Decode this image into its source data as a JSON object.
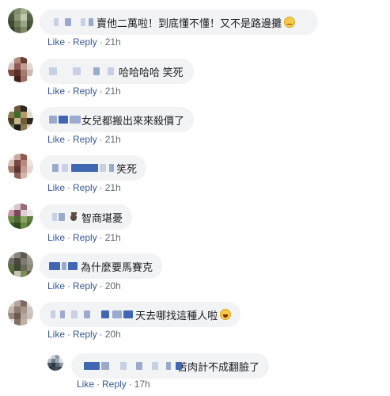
{
  "labels": {
    "like": "Like",
    "reply": "Reply",
    "sep": "·"
  },
  "colors": {
    "link": "#385898",
    "bubble": "#f2f3f5",
    "name_redacted": "#4267b2"
  },
  "comments": [
    {
      "text": "賣他二萬啦！到底懂不懂！又不是路邊攤",
      "emoji": "smirk-emoji",
      "time": "21h"
    },
    {
      "text": "哈哈哈哈 笑死",
      "time": "21h"
    },
    {
      "text": "女兒都搬出來來殺價了",
      "time": "21h"
    },
    {
      "text": "笑死",
      "time": "21h"
    },
    {
      "text": "智商堪憂",
      "icon": "waving-hand-icon",
      "time": "21h"
    },
    {
      "text": "為什麼要馬賽克",
      "time": "20h"
    },
    {
      "text": "天去哪找這種人啦",
      "emoji": "laughing-tears-emoji",
      "time": "20h"
    }
  ],
  "reply": {
    "text": "苦肉計不成翻臉了",
    "time": "17h"
  }
}
